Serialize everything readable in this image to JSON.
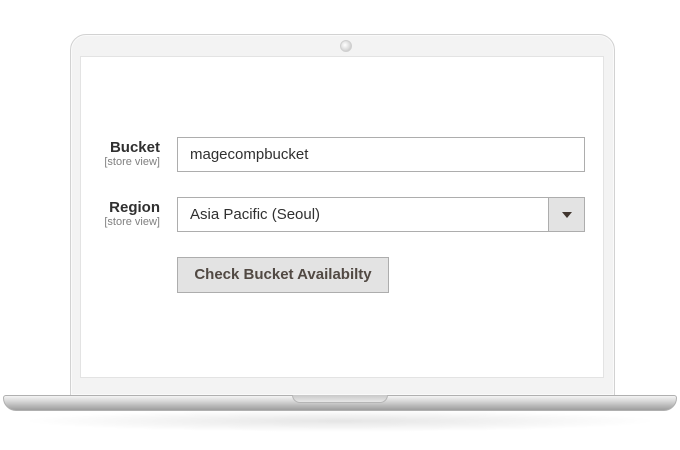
{
  "form": {
    "bucket": {
      "label": "Bucket",
      "scope": "[store view]",
      "value": "magecompbucket"
    },
    "region": {
      "label": "Region",
      "scope": "[store view]",
      "selected": "Asia Pacific (Seoul)"
    },
    "check_button_label": "Check Bucket Availabilty"
  },
  "icons": {
    "select_arrow": "chevron-down-icon",
    "camera": "camera-icon"
  },
  "colors": {
    "label_text": "#303030",
    "scope_text": "#808080",
    "field_border": "#adadad",
    "button_bg": "#e3e3e3",
    "button_text": "#514943"
  }
}
